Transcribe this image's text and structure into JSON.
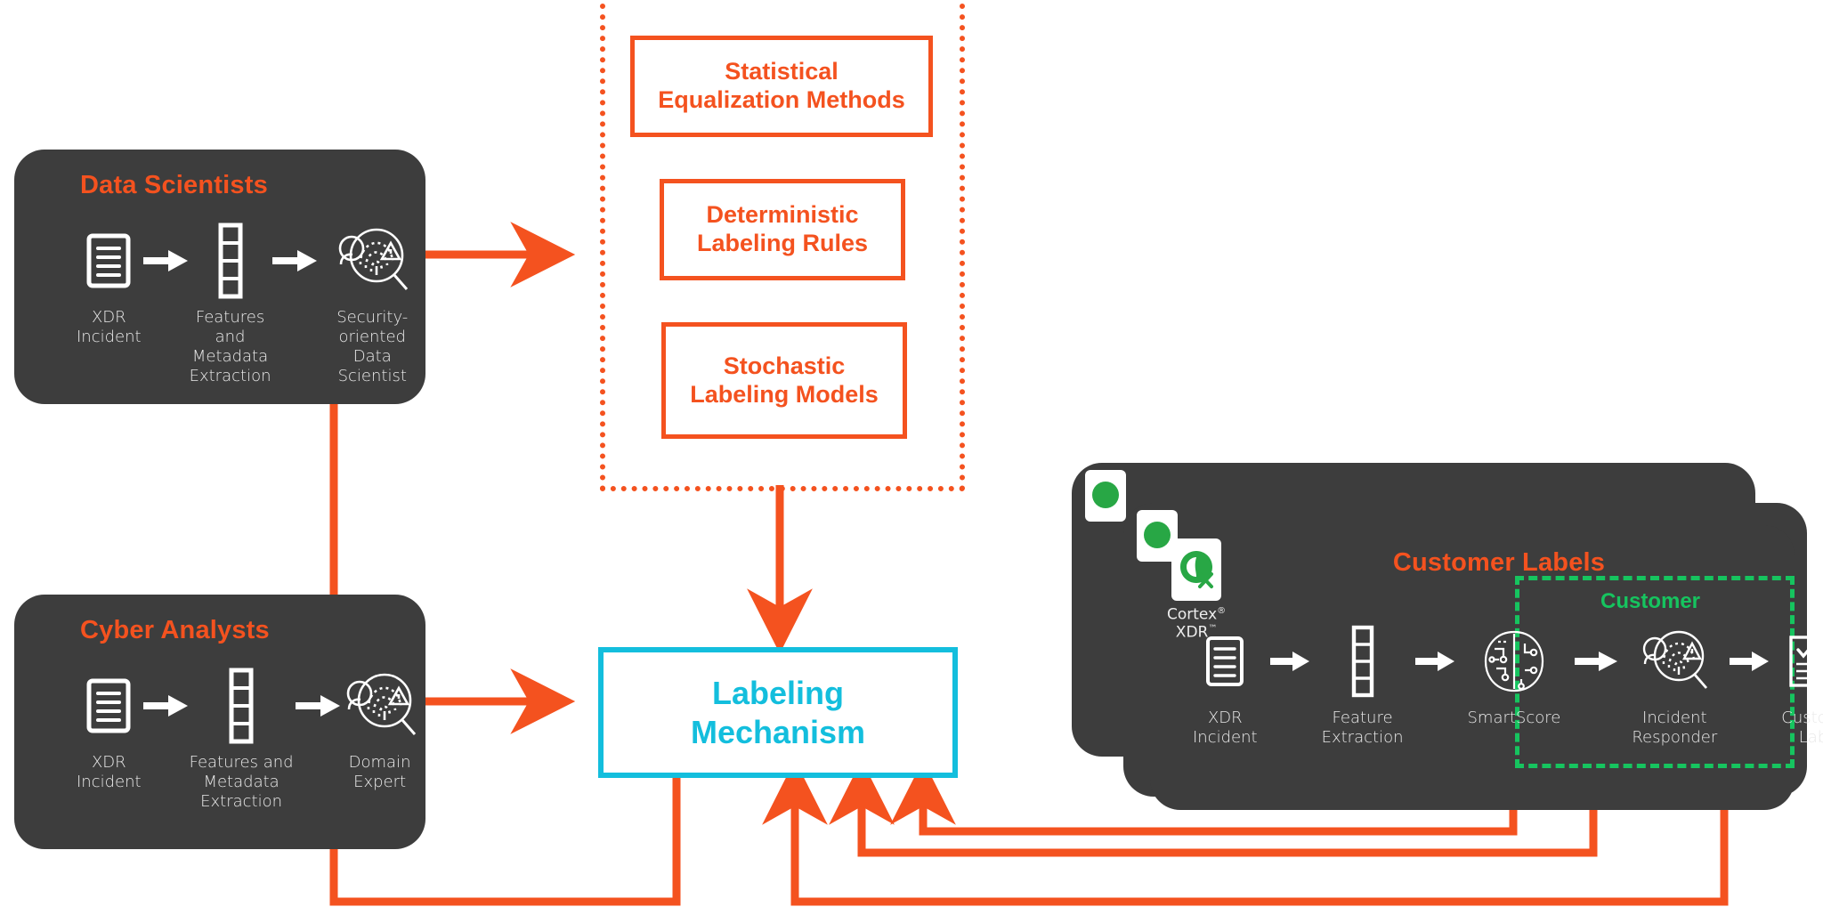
{
  "colors": {
    "orange": "#f4521f",
    "cyan": "#13bedd",
    "green": "#16c45f",
    "panel_bg": "#3d3d3d",
    "caption": "#e9e9e9",
    "page_bg": "#ffffff"
  },
  "data_scientists": {
    "title": "Data Scientists",
    "steps": [
      {
        "icon": "document-icon",
        "caption": "XDR\nIncident"
      },
      {
        "icon": "feature-vector-icon",
        "caption": "Features and\nMetadata\nExtraction"
      },
      {
        "icon": "fingerprint-magnifier-icon",
        "caption": "Security-oriented\nData Scientist"
      }
    ]
  },
  "cyber_analysts": {
    "title": "Cyber Analysts",
    "steps": [
      {
        "icon": "document-icon",
        "caption": "XDR\nIncident"
      },
      {
        "icon": "feature-vector-icon",
        "caption": "Features and\nMetadata\nExtraction"
      },
      {
        "icon": "fingerprint-magnifier-icon",
        "caption": "Domain\nExpert"
      }
    ]
  },
  "methods_group": {
    "boxes": [
      {
        "label": "Statistical\nEqualization Methods"
      },
      {
        "label": "Deterministic\nLabeling Rules"
      },
      {
        "label": "Stochastic\nLabeling Models"
      }
    ]
  },
  "labeling_mechanism": {
    "label": "Labeling\nMechanism"
  },
  "customer_labels": {
    "title": "Customer Labels",
    "product": {
      "name": "Cortex",
      "name_sup": "®",
      "sub": "XDR",
      "sub_sup": "™",
      "icon": "cortex-xdr-logo"
    },
    "steps": [
      {
        "icon": "document-icon",
        "caption": "XDR\nIncident"
      },
      {
        "icon": "feature-vector-icon",
        "caption": "Feature\nExtraction"
      },
      {
        "icon": "brain-circuit-icon",
        "caption": "SmartScore"
      },
      {
        "icon": "fingerprint-magnifier-icon",
        "caption": "Incident\nResponder"
      },
      {
        "icon": "checklist-icon",
        "caption": "Customer\nLabel"
      }
    ],
    "customer_group": {
      "title": "Customer"
    }
  }
}
